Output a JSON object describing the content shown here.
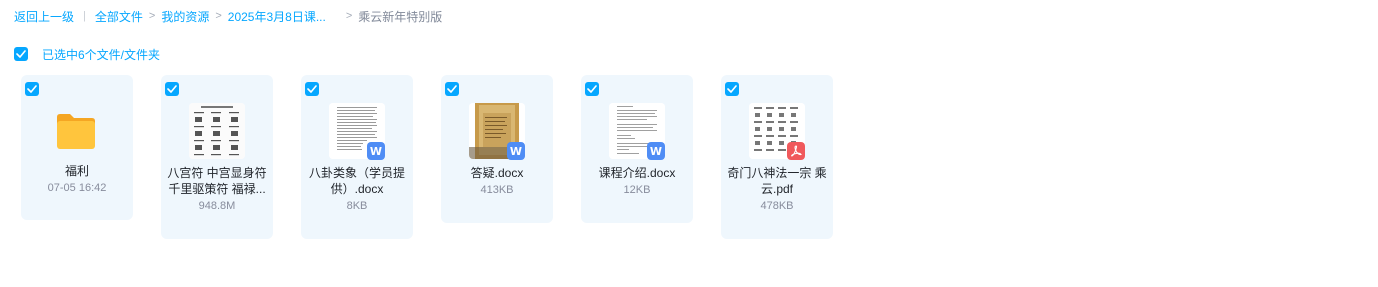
{
  "breadcrumb": {
    "back": "返回上一级",
    "all_files": "全部文件",
    "my_resources": "我的资源",
    "course": "2025年3月8日课...",
    "current": "乘云新年特别版"
  },
  "selection": {
    "label": "已选中6个文件/文件夹"
  },
  "files": [
    {
      "name": "福利",
      "meta": "07-05 16:42",
      "type": "folder",
      "checked": true
    },
    {
      "name": "八宫符 中宫显身符 千里驱策符 福禄...",
      "meta": "948.8M",
      "type": "image",
      "checked": true
    },
    {
      "name": "八卦类象（学员提供）.docx",
      "meta": "8KB",
      "type": "docx",
      "checked": true
    },
    {
      "name": "答疑.docx",
      "meta": "413KB",
      "type": "docx",
      "checked": true
    },
    {
      "name": "课程介绍.docx",
      "meta": "12KB",
      "type": "docx",
      "checked": true
    },
    {
      "name": "奇门八神法一宗 乘云.pdf",
      "meta": "478KB",
      "type": "pdf",
      "checked": true
    }
  ],
  "colors": {
    "accent": "#06a7ff",
    "card_bg": "#eff7fd",
    "word_badge": "#4f8df5",
    "pdf_badge": "#f0595c",
    "folder": "#ffc53d"
  }
}
